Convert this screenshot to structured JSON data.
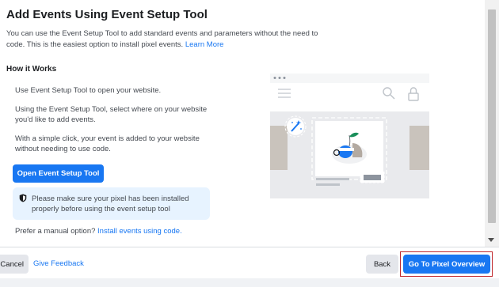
{
  "dialog": {
    "title": "Add Events Using Event Setup Tool",
    "intro_text": "You can use the Event Setup Tool to add standard events and parameters without the need to code. This is the easiest option to install pixel events.",
    "learn_more": "Learn More",
    "how_it_works": "How it Works",
    "steps": [
      "Use Event Setup Tool to open your website.",
      "Using the Event Setup Tool, select where on your website you'd like to add events.",
      "With a simple click, your event is added to your website without needing to use code."
    ],
    "open_button": "Open Event Setup Tool",
    "notice": {
      "icon": "shield-icon",
      "text": "Please make sure your pixel has been installed properly before using the event setup tool"
    },
    "manual_prefix": "Prefer a manual option?",
    "manual_link": "Install events using code."
  },
  "footer": {
    "cancel": "Cancel",
    "give_feedback": "Give Feedback",
    "back": "Back",
    "go_to_pixel_overview": "Go To Pixel Overview"
  },
  "colors": {
    "accent": "#1877f2",
    "notice_bg": "#e7f3ff",
    "highlight_outline": "#c0282d"
  }
}
